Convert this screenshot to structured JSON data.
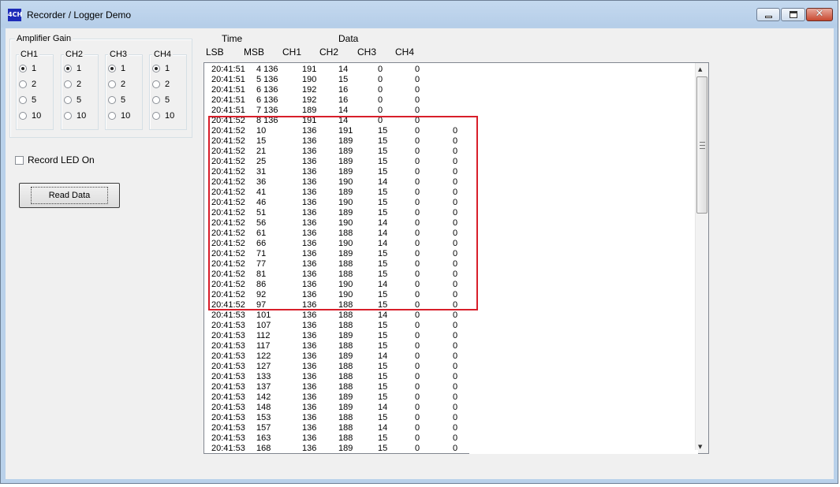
{
  "window": {
    "title": "Recorder / Logger Demo",
    "icon": "4CH"
  },
  "gain": {
    "title": "Amplifier Gain",
    "channels": [
      {
        "label": "CH1",
        "options": [
          "1",
          "2",
          "5",
          "10"
        ],
        "selected": "1"
      },
      {
        "label": "CH2",
        "options": [
          "1",
          "2",
          "5",
          "10"
        ],
        "selected": "1"
      },
      {
        "label": "CH3",
        "options": [
          "1",
          "2",
          "5",
          "10"
        ],
        "selected": "1"
      },
      {
        "label": "CH4",
        "options": [
          "1",
          "2",
          "5",
          "10"
        ],
        "selected": "1"
      }
    ]
  },
  "record_led": {
    "label": "Record LED On",
    "checked": false
  },
  "read_button": {
    "label": "Read Data"
  },
  "headers": {
    "time": "Time",
    "data": "Data",
    "lsb": "LSB",
    "msb": "MSB",
    "ch1": "CH1",
    "ch2": "CH2",
    "ch3": "CH3",
    "ch4": "CH4"
  },
  "rows": [
    [
      "20:41:51",
      "4 136",
      "191",
      "14",
      "0",
      "0",
      ""
    ],
    [
      "20:41:51",
      "5 136",
      "190",
      "15",
      "0",
      "0",
      ""
    ],
    [
      "20:41:51",
      "6 136",
      "192",
      "16",
      "0",
      "0",
      ""
    ],
    [
      "20:41:51",
      "6 136",
      "192",
      "16",
      "0",
      "0",
      ""
    ],
    [
      "20:41:51",
      "7 136",
      "189",
      "14",
      "0",
      "0",
      ""
    ],
    [
      "20:41:52",
      "8 136",
      "191",
      "14",
      "0",
      "0",
      ""
    ],
    [
      "20:41:52",
      "10",
      "136",
      "191",
      "15",
      "0",
      "0"
    ],
    [
      "20:41:52",
      "15",
      "136",
      "189",
      "15",
      "0",
      "0"
    ],
    [
      "20:41:52",
      "21",
      "136",
      "189",
      "15",
      "0",
      "0"
    ],
    [
      "20:41:52",
      "25",
      "136",
      "189",
      "15",
      "0",
      "0"
    ],
    [
      "20:41:52",
      "31",
      "136",
      "189",
      "15",
      "0",
      "0"
    ],
    [
      "20:41:52",
      "36",
      "136",
      "190",
      "14",
      "0",
      "0"
    ],
    [
      "20:41:52",
      "41",
      "136",
      "189",
      "15",
      "0",
      "0"
    ],
    [
      "20:41:52",
      "46",
      "136",
      "190",
      "15",
      "0",
      "0"
    ],
    [
      "20:41:52",
      "51",
      "136",
      "189",
      "15",
      "0",
      "0"
    ],
    [
      "20:41:52",
      "56",
      "136",
      "190",
      "14",
      "0",
      "0"
    ],
    [
      "20:41:52",
      "61",
      "136",
      "188",
      "14",
      "0",
      "0"
    ],
    [
      "20:41:52",
      "66",
      "136",
      "190",
      "14",
      "0",
      "0"
    ],
    [
      "20:41:52",
      "71",
      "136",
      "189",
      "15",
      "0",
      "0"
    ],
    [
      "20:41:52",
      "77",
      "136",
      "188",
      "15",
      "0",
      "0"
    ],
    [
      "20:41:52",
      "81",
      "136",
      "188",
      "15",
      "0",
      "0"
    ],
    [
      "20:41:52",
      "86",
      "136",
      "190",
      "14",
      "0",
      "0"
    ],
    [
      "20:41:52",
      "92",
      "136",
      "190",
      "15",
      "0",
      "0"
    ],
    [
      "20:41:52",
      "97",
      "136",
      "188",
      "15",
      "0",
      "0"
    ],
    [
      "20:41:53",
      "101",
      "136",
      "188",
      "14",
      "0",
      "0"
    ],
    [
      "20:41:53",
      "107",
      "136",
      "188",
      "15",
      "0",
      "0"
    ],
    [
      "20:41:53",
      "112",
      "136",
      "189",
      "15",
      "0",
      "0"
    ],
    [
      "20:41:53",
      "117",
      "136",
      "188",
      "15",
      "0",
      "0"
    ],
    [
      "20:41:53",
      "122",
      "136",
      "189",
      "14",
      "0",
      "0"
    ],
    [
      "20:41:53",
      "127",
      "136",
      "188",
      "15",
      "0",
      "0"
    ],
    [
      "20:41:53",
      "133",
      "136",
      "188",
      "15",
      "0",
      "0"
    ],
    [
      "20:41:53",
      "137",
      "136",
      "188",
      "15",
      "0",
      "0"
    ],
    [
      "20:41:53",
      "142",
      "136",
      "189",
      "15",
      "0",
      "0"
    ],
    [
      "20:41:53",
      "148",
      "136",
      "189",
      "14",
      "0",
      "0"
    ],
    [
      "20:41:53",
      "153",
      "136",
      "188",
      "15",
      "0",
      "0"
    ],
    [
      "20:41:53",
      "157",
      "136",
      "188",
      "14",
      "0",
      "0"
    ],
    [
      "20:41:53",
      "163",
      "136",
      "188",
      "15",
      "0",
      "0"
    ],
    [
      "20:41:53",
      "168",
      "136",
      "189",
      "15",
      "0",
      "0"
    ]
  ],
  "colors": {
    "highlight": "#d81e2a",
    "titlebar": "#b9d1ea"
  }
}
